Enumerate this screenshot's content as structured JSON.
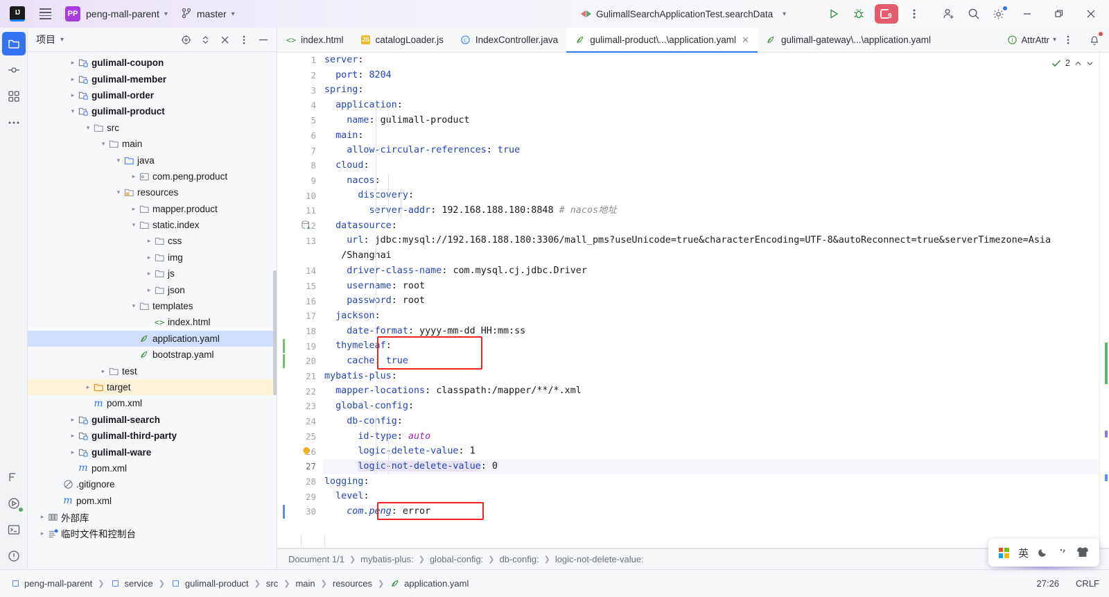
{
  "titlebar": {
    "logo": "IJ",
    "project_name": "peng-mall-parent",
    "branch": "master",
    "run_config": "GulimallSearchApplicationTest.searchData",
    "debug_badge_count": "9"
  },
  "project_panel": {
    "title": "项目",
    "tree": [
      {
        "indent": 2,
        "arrow": "right",
        "icon": "module-icon",
        "label": "gulimall-coupon",
        "bold": true,
        "state": "normal"
      },
      {
        "indent": 2,
        "arrow": "right",
        "icon": "module-icon",
        "label": "gulimall-member",
        "bold": true,
        "state": "normal"
      },
      {
        "indent": 2,
        "arrow": "right",
        "icon": "module-icon",
        "label": "gulimall-order",
        "bold": true,
        "state": "normal"
      },
      {
        "indent": 2,
        "arrow": "down",
        "icon": "module-icon",
        "label": "gulimall-product",
        "bold": true,
        "state": "normal"
      },
      {
        "indent": 3,
        "arrow": "down",
        "icon": "folder-icon",
        "label": "src",
        "bold": false,
        "state": "normal"
      },
      {
        "indent": 4,
        "arrow": "down",
        "icon": "folder-icon",
        "label": "main",
        "bold": false,
        "state": "normal"
      },
      {
        "indent": 5,
        "arrow": "down",
        "icon": "source-folder-icon",
        "label": "java",
        "bold": false,
        "state": "normal"
      },
      {
        "indent": 6,
        "arrow": "right",
        "icon": "package-icon",
        "label": "com.peng.product",
        "bold": false,
        "state": "normal"
      },
      {
        "indent": 5,
        "arrow": "down",
        "icon": "resource-folder-icon",
        "label": "resources",
        "bold": false,
        "state": "normal"
      },
      {
        "indent": 6,
        "arrow": "right",
        "icon": "folder-icon",
        "label": "mapper.product",
        "bold": false,
        "state": "normal"
      },
      {
        "indent": 6,
        "arrow": "down",
        "icon": "folder-icon",
        "label": "static.index",
        "bold": false,
        "state": "normal"
      },
      {
        "indent": 7,
        "arrow": "right",
        "icon": "folder-icon",
        "label": "css",
        "bold": false,
        "state": "normal"
      },
      {
        "indent": 7,
        "arrow": "right",
        "icon": "folder-icon",
        "label": "img",
        "bold": false,
        "state": "normal"
      },
      {
        "indent": 7,
        "arrow": "right",
        "icon": "folder-icon",
        "label": "js",
        "bold": false,
        "state": "normal"
      },
      {
        "indent": 7,
        "arrow": "right",
        "icon": "folder-icon",
        "label": "json",
        "bold": false,
        "state": "normal"
      },
      {
        "indent": 6,
        "arrow": "down",
        "icon": "folder-icon",
        "label": "templates",
        "bold": false,
        "state": "normal"
      },
      {
        "indent": 7,
        "arrow": "none",
        "icon": "html-icon",
        "label": "index.html",
        "bold": false,
        "state": "normal"
      },
      {
        "indent": 6,
        "arrow": "none",
        "icon": "yaml-icon",
        "label": "application.yaml",
        "bold": false,
        "state": "selected"
      },
      {
        "indent": 6,
        "arrow": "none",
        "icon": "yaml-icon",
        "label": "bootstrap.yaml",
        "bold": false,
        "state": "normal"
      },
      {
        "indent": 4,
        "arrow": "right",
        "icon": "folder-icon",
        "label": "test",
        "bold": false,
        "state": "normal"
      },
      {
        "indent": 3,
        "arrow": "right",
        "icon": "target-folder-icon",
        "label": "target",
        "bold": false,
        "state": "target"
      },
      {
        "indent": 3,
        "arrow": "none",
        "icon": "maven-icon",
        "label": "pom.xml",
        "bold": false,
        "state": "normal"
      },
      {
        "indent": 2,
        "arrow": "right",
        "icon": "module-icon",
        "label": "gulimall-search",
        "bold": true,
        "state": "normal"
      },
      {
        "indent": 2,
        "arrow": "right",
        "icon": "module-icon",
        "label": "gulimall-third-party",
        "bold": true,
        "state": "normal"
      },
      {
        "indent": 2,
        "arrow": "right",
        "icon": "module-icon",
        "label": "gulimall-ware",
        "bold": true,
        "state": "normal"
      },
      {
        "indent": 2,
        "arrow": "none",
        "icon": "maven-icon",
        "label": "pom.xml",
        "bold": false,
        "state": "normal"
      },
      {
        "indent": 1,
        "arrow": "none",
        "icon": "gitignore-icon",
        "label": ".gitignore",
        "bold": false,
        "state": "normal"
      },
      {
        "indent": 1,
        "arrow": "none",
        "icon": "maven-icon",
        "label": "pom.xml",
        "bold": false,
        "state": "normal"
      },
      {
        "indent": 0,
        "arrow": "right",
        "icon": "library-icon",
        "label": "外部库",
        "bold": false,
        "state": "normal"
      },
      {
        "indent": 0,
        "arrow": "right",
        "icon": "scratches-icon",
        "label": "临时文件和控制台",
        "bold": false,
        "state": "normal"
      }
    ]
  },
  "editor": {
    "tabs": [
      {
        "label": "index.html",
        "icon": "html-icon",
        "active": false,
        "closable": false
      },
      {
        "label": "catalogLoader.js",
        "icon": "js-icon",
        "active": false,
        "closable": false
      },
      {
        "label": "IndexController.java",
        "icon": "class-icon",
        "active": false,
        "closable": false
      },
      {
        "label": "gulimall-product\\...\\application.yaml",
        "icon": "yaml-icon",
        "active": true,
        "closable": true
      },
      {
        "label": "gulimall-gateway\\...\\application.yaml",
        "icon": "yaml-icon",
        "active": false,
        "closable": false
      }
    ],
    "tabbar_right": {
      "inspection_label": "AttrAttr",
      "inspection_icon": "inspection-ok-icon",
      "more_icon": "more-vertical-icon"
    },
    "inspection_widget": {
      "count": "2",
      "icon": "checkmark-icon"
    },
    "lines": [
      {
        "n": "1",
        "indent": 0,
        "key": "server",
        "sep": ":",
        "val": "",
        "valtype": "none"
      },
      {
        "n": "2",
        "indent": 1,
        "key": "port",
        "sep": ":",
        "val": "8204",
        "valtype": "num"
      },
      {
        "n": "3",
        "indent": 0,
        "key": "spring",
        "sep": ":",
        "val": "",
        "valtype": "none"
      },
      {
        "n": "4",
        "indent": 1,
        "key": "application",
        "sep": ":",
        "val": "",
        "valtype": "none"
      },
      {
        "n": "5",
        "indent": 2,
        "key": "name",
        "sep": ":",
        "val": "gulimall-product",
        "valtype": "plain"
      },
      {
        "n": "6",
        "indent": 1,
        "key": "main",
        "sep": ":",
        "val": "",
        "valtype": "none"
      },
      {
        "n": "7",
        "indent": 2,
        "key": "allow-circular-references",
        "sep": ":",
        "val": "true",
        "valtype": "num"
      },
      {
        "n": "8",
        "indent": 1,
        "key": "cloud",
        "sep": ":",
        "val": "",
        "valtype": "none"
      },
      {
        "n": "9",
        "indent": 2,
        "key": "nacos",
        "sep": ":",
        "val": "",
        "valtype": "none"
      },
      {
        "n": "10",
        "indent": 3,
        "key": "discovery",
        "sep": ":",
        "val": "",
        "valtype": "none"
      },
      {
        "n": "11",
        "indent": 4,
        "key": "server-addr",
        "sep": ":",
        "val": "192.168.188.180:8848",
        "valtype": "plain",
        "comment": "# nacos地址"
      },
      {
        "n": "12",
        "indent": 1,
        "key": "datasource",
        "sep": ":",
        "val": "",
        "valtype": "none",
        "gutter_icon": "database-icon"
      },
      {
        "n": "13",
        "indent": 2,
        "key": "url",
        "sep": ":",
        "val": "jdbc:mysql://192.168.188.180:3306/mall_pms?useUnicode=true&characterEncoding=UTF-8&autoReconnect=true&serverTimezone=Asia",
        "valtype": "plain",
        "wrap": "/Shanghai"
      },
      {
        "n": "14",
        "indent": 2,
        "key": "driver-class-name",
        "sep": ":",
        "val": "com.mysql.cj.jdbc.Driver",
        "valtype": "plain"
      },
      {
        "n": "15",
        "indent": 2,
        "key": "username",
        "sep": ":",
        "val": "root",
        "valtype": "plain"
      },
      {
        "n": "16",
        "indent": 2,
        "key": "password",
        "sep": ":",
        "val": "root",
        "valtype": "plain"
      },
      {
        "n": "17",
        "indent": 1,
        "key": "jackson",
        "sep": ":",
        "val": "",
        "valtype": "none"
      },
      {
        "n": "18",
        "indent": 2,
        "key": "date-format",
        "sep": ":",
        "val": "yyyy-mm-dd HH:mm:ss",
        "valtype": "plain"
      },
      {
        "n": "19",
        "indent": 1,
        "key": "thymeleaf",
        "sep": ":",
        "val": "",
        "valtype": "none",
        "changed": "green"
      },
      {
        "n": "20",
        "indent": 2,
        "key": "cache",
        "sep": ":",
        "val": "true",
        "valtype": "num",
        "changed": "green"
      },
      {
        "n": "21",
        "indent": 0,
        "key": "mybatis-plus",
        "sep": ":",
        "val": "",
        "valtype": "none"
      },
      {
        "n": "22",
        "indent": 1,
        "key": "mapper-locations",
        "sep": ":",
        "val": "classpath:/mapper/**/*.xml",
        "valtype": "plain"
      },
      {
        "n": "23",
        "indent": 1,
        "key": "global-config",
        "sep": ":",
        "val": "",
        "valtype": "none"
      },
      {
        "n": "24",
        "indent": 2,
        "key": "db-config",
        "sep": ":",
        "val": "",
        "valtype": "none"
      },
      {
        "n": "25",
        "indent": 3,
        "key": "id-type",
        "sep": ":",
        "val": "auto",
        "valtype": "italic"
      },
      {
        "n": "26",
        "indent": 3,
        "key": "logic-delete-value",
        "sep": ":",
        "val": "1",
        "valtype": "plain",
        "gutter_icon": "bulb-icon"
      },
      {
        "n": "27",
        "indent": 3,
        "key": "logic-not-delete-value",
        "sep": ":",
        "val": "0",
        "valtype": "plain",
        "current": true,
        "key_selected": true
      },
      {
        "n": "28",
        "indent": 0,
        "key": "logging",
        "sep": ":",
        "val": "",
        "valtype": "none"
      },
      {
        "n": "29",
        "indent": 1,
        "key": "level",
        "sep": ":",
        "val": "",
        "valtype": "none"
      },
      {
        "n": "30",
        "indent": 2,
        "key": "com.peng",
        "sep": ":",
        "val": "error",
        "valtype": "plain",
        "keystyle": "italic",
        "changed": "blue"
      }
    ],
    "annotations": [
      {
        "type": "red-box",
        "lines": "19-20"
      },
      {
        "type": "red-box",
        "lines": "30"
      }
    ],
    "breadcrumbs": [
      "Document 1/1",
      "mybatis-plus:",
      "global-config:",
      "db-config:",
      "logic-not-delete-value:"
    ]
  },
  "statusbar": {
    "crumbs": [
      {
        "label": "peng-mall-parent",
        "icon": "module-square-icon"
      },
      {
        "label": "service",
        "icon": "module-square-icon"
      },
      {
        "label": "gulimall-product",
        "icon": "module-square-icon"
      },
      {
        "label": "src",
        "icon": ""
      },
      {
        "label": "main",
        "icon": ""
      },
      {
        "label": "resources",
        "icon": ""
      },
      {
        "label": "application.yaml",
        "icon": "yaml-icon"
      }
    ],
    "caret_position": "27:26",
    "line_separator": "CRLF"
  },
  "ime": {
    "lang": "英",
    "icons": [
      "windows-icon",
      "moon-icon",
      "comma-icon",
      "shirt-icon"
    ]
  },
  "colors": {
    "accent": "#3574f0",
    "selection": "#cfdefc",
    "target_row": "#fdf3d8",
    "red_annotation": "#ee2222",
    "debug_badge": "#e55c6c",
    "keyword": "#2244bb"
  }
}
